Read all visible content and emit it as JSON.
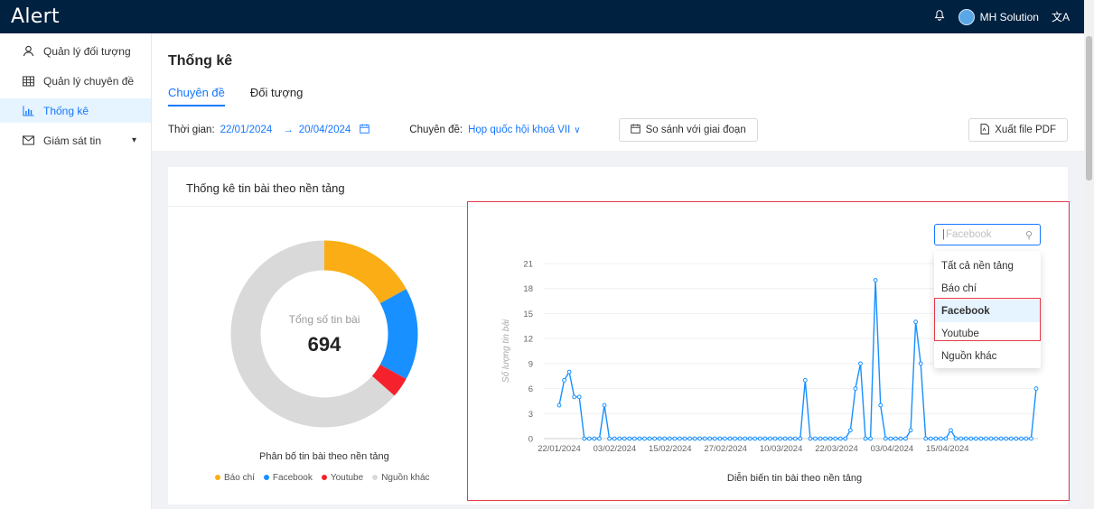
{
  "app": {
    "logo": "Alert",
    "user_name": "MH Solution",
    "lang_icon": "translate-icon",
    "bell_icon": "bell-icon"
  },
  "sidebar": {
    "items": [
      {
        "label": "Quản lý đối tượng",
        "icon": "user-icon"
      },
      {
        "label": "Quản lý chuyên đề",
        "icon": "table-icon"
      },
      {
        "label": "Thống kê",
        "icon": "bar-chart-icon",
        "active": true
      },
      {
        "label": "Giám sát tin",
        "icon": "mail-icon"
      }
    ]
  },
  "page": {
    "title": "Thống kê",
    "tabs": [
      "Chuyên đề",
      "Đối tượng"
    ],
    "filters": {
      "time_label": "Thời gian:",
      "date_from": "22/01/2024",
      "arrow": "→",
      "date_to": "20/04/2024",
      "topic_label": "Chuyên đề:",
      "topic_value": "Họp quốc hội khoá VII",
      "compare_button": "So sánh với giai đoạn",
      "export_button": "Xuất file PDF"
    }
  },
  "card": {
    "title": "Thống kê tin bài theo nền tảng",
    "donut": {
      "center_label": "Tổng số tin bài",
      "total": "694",
      "caption": "Phân bố tin bài theo nền tảng",
      "legend": [
        {
          "name": "Báo chí",
          "color": "#faad14"
        },
        {
          "name": "Facebook",
          "color": "#1890ff"
        },
        {
          "name": "Youtube",
          "color": "#f5222d"
        },
        {
          "name": "Nguồn khác",
          "color": "#d9d9d9"
        }
      ]
    },
    "platform_select": {
      "placeholder": "Facebook",
      "options": [
        "Tất cả nền tảng",
        "Báo chí",
        "Facebook",
        "Youtube",
        "Nguồn khác"
      ],
      "selected": "Facebook"
    }
  },
  "chart_data": [
    {
      "type": "pie",
      "categories": [
        "Báo chí",
        "Facebook",
        "Youtube",
        "Nguồn khác"
      ],
      "values": [
        0.17,
        0.16,
        0.035,
        0.635
      ]
    },
    {
      "type": "line",
      "title": "Diễn biến tin bài theo nền tảng",
      "ylabel": "Số lượng tin bài",
      "ylim": [
        0,
        21
      ],
      "yticks": [
        0,
        3,
        6,
        9,
        12,
        15,
        18,
        21
      ],
      "xtick_labels": [
        "22/01/2024",
        "03/02/2024",
        "15/02/2024",
        "27/02/2024",
        "10/03/2024",
        "22/03/2024",
        "03/04/2024",
        "15/04/2024"
      ],
      "values": [
        4,
        7,
        8,
        5,
        5,
        0,
        0,
        0,
        0,
        4,
        0,
        0,
        0,
        0,
        0,
        0,
        0,
        0,
        0,
        0,
        0,
        0,
        0,
        0,
        0,
        0,
        0,
        0,
        0,
        0,
        0,
        0,
        0,
        0,
        0,
        0,
        0,
        0,
        0,
        0,
        0,
        0,
        0,
        0,
        0,
        0,
        0,
        0,
        0,
        7,
        0,
        0,
        0,
        0,
        0,
        0,
        0,
        0,
        1,
        6,
        9,
        0,
        0,
        19,
        4,
        0,
        0,
        0,
        0,
        0,
        1,
        14,
        9,
        0,
        0,
        0,
        0,
        0,
        1,
        0,
        0,
        0,
        0,
        0,
        0,
        0,
        0,
        0,
        0,
        0,
        0,
        0,
        0,
        0,
        0,
        6
      ],
      "series": [
        {
          "color": "#1890ff"
        }
      ]
    }
  ]
}
